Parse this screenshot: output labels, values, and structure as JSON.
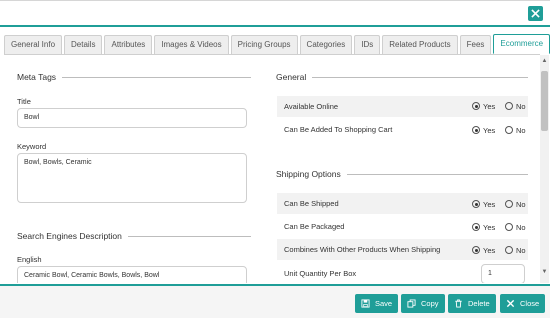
{
  "tabs": [
    {
      "label": "General Info",
      "active": false
    },
    {
      "label": "Details",
      "active": false
    },
    {
      "label": "Attributes",
      "active": false
    },
    {
      "label": "Images & Videos",
      "active": false
    },
    {
      "label": "Pricing Groups",
      "active": false
    },
    {
      "label": "Categories",
      "active": false
    },
    {
      "label": "IDs",
      "active": false
    },
    {
      "label": "Related Products",
      "active": false
    },
    {
      "label": "Fees",
      "active": false
    },
    {
      "label": "Ecommerce",
      "active": true
    }
  ],
  "meta": {
    "section_title": "Meta Tags",
    "title_label": "Title",
    "title_value": "Bowl",
    "keyword_label": "Keyword",
    "keyword_value": "Bowl, Bowls, Ceramic"
  },
  "seo": {
    "section_title": "Search Engines Description",
    "english_label": "English",
    "english_value": "Ceramic Bowl, Ceramic Bowls, Bowls, Bowl"
  },
  "general": {
    "section_title": "General",
    "rows": [
      {
        "label": "Available Online",
        "yes": "Yes",
        "no": "No",
        "selected": "Yes"
      },
      {
        "label": "Can Be Added To Shopping Cart",
        "yes": "Yes",
        "no": "No",
        "selected": "Yes"
      }
    ]
  },
  "shipping": {
    "section_title": "Shipping Options",
    "rows": [
      {
        "label": "Can Be Shipped",
        "yes": "Yes",
        "no": "No",
        "selected": "Yes"
      },
      {
        "label": "Can Be Packaged",
        "yes": "Yes",
        "no": "No",
        "selected": "Yes"
      },
      {
        "label": "Combines With Other Products When Shipping",
        "yes": "Yes",
        "no": "No",
        "selected": "Yes"
      }
    ],
    "unit_qty_label": "Unit Quantity Per Box",
    "unit_qty_value": "1"
  },
  "footer": {
    "save": "Save",
    "copy": "Copy",
    "delete": "Delete",
    "close": "Close"
  },
  "colors": {
    "accent": "#1f9e98"
  }
}
